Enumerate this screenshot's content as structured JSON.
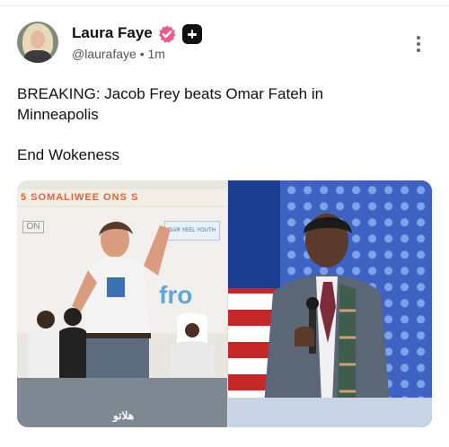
{
  "post": {
    "author_name": "Laura Faye",
    "handle": "@laurafaye",
    "separator": "•",
    "timestamp": "1m",
    "text_line1": "BREAKING: Jacob Frey beats Omar Fateh in",
    "text_line2": "Minneapolis",
    "text_line3": "End Wokeness",
    "badge_verified_icon": "verified-badge-icon",
    "badge_plus_icon": "plus-icon",
    "more_icon": "more-vertical-icon"
  },
  "media": {
    "left_caption": "هلاتو",
    "left_banner_text": "5 SOMALIWEE  ONS  S",
    "left_sign_left": "ON",
    "left_sign_right": "DAR YEEL YOUTH",
    "left_fro_text": "fro",
    "colors": {
      "accent_orange": "#d7673a",
      "flag_blue": "#1b3d8f",
      "flag_red": "#c62828"
    }
  }
}
